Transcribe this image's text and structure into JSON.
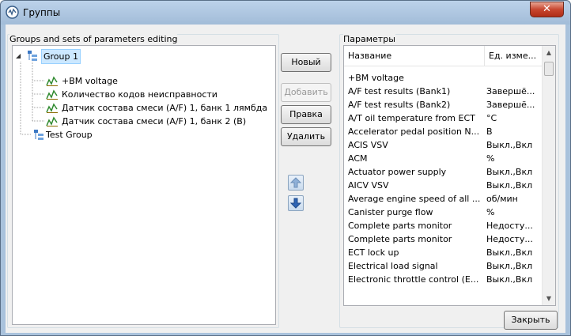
{
  "window": {
    "title": "Группы",
    "close_glyph": "✕"
  },
  "groups_panel": {
    "title": "Groups and sets of parameters editing",
    "tree": [
      {
        "label": "Group 1",
        "type": "group",
        "expanded": true,
        "selected": true
      },
      {
        "label": "+BM voltage",
        "type": "param"
      },
      {
        "label": "Количество кодов неисправности",
        "type": "param"
      },
      {
        "label": "Датчик состава смеси (A/F) 1, банк 1 лямбда",
        "type": "param"
      },
      {
        "label": "Датчик состава смеси (A/F) 1, банк 2 (B)",
        "type": "param"
      },
      {
        "label": "Test Group",
        "type": "group"
      }
    ]
  },
  "buttons": {
    "new": "Новый",
    "add": "Добавить",
    "edit": "Правка",
    "delete": "Удалить"
  },
  "params_panel": {
    "title": "Параметры",
    "columns": [
      "Название",
      "Ед. изме..."
    ],
    "rows": [
      [
        "+BM voltage",
        ""
      ],
      [
        "A/F test results (Bank1)",
        "Завершё..."
      ],
      [
        "A/F test results (Bank2)",
        "Завершё..."
      ],
      [
        "A/T oil temperature from ECT",
        "°C"
      ],
      [
        "Accelerator pedal position N...",
        "В"
      ],
      [
        "ACIS VSV",
        "Выкл.,Вкл"
      ],
      [
        "ACM",
        "%"
      ],
      [
        "Actuator power supply",
        "Выкл.,Вкл"
      ],
      [
        "AICV VSV",
        "Выкл.,Вкл"
      ],
      [
        "Average engine speed of all ...",
        "об/мин"
      ],
      [
        "Canister purge flow",
        "%"
      ],
      [
        "Complete parts monitor",
        "Недосту..."
      ],
      [
        "Complete parts monitor",
        "Недосту..."
      ],
      [
        "ECT lock up",
        "Выкл.,Вкл"
      ],
      [
        "Electrical load signal",
        "Выкл.,Вкл"
      ],
      [
        "Electronic throttle control (E...",
        "Выкл.,Вкл"
      ]
    ]
  },
  "footer": {
    "close": "Закрыть"
  },
  "colors": {
    "titlebar": "#a9c2dc",
    "selection": "#cce8ff",
    "close_red": "#c7462f"
  }
}
